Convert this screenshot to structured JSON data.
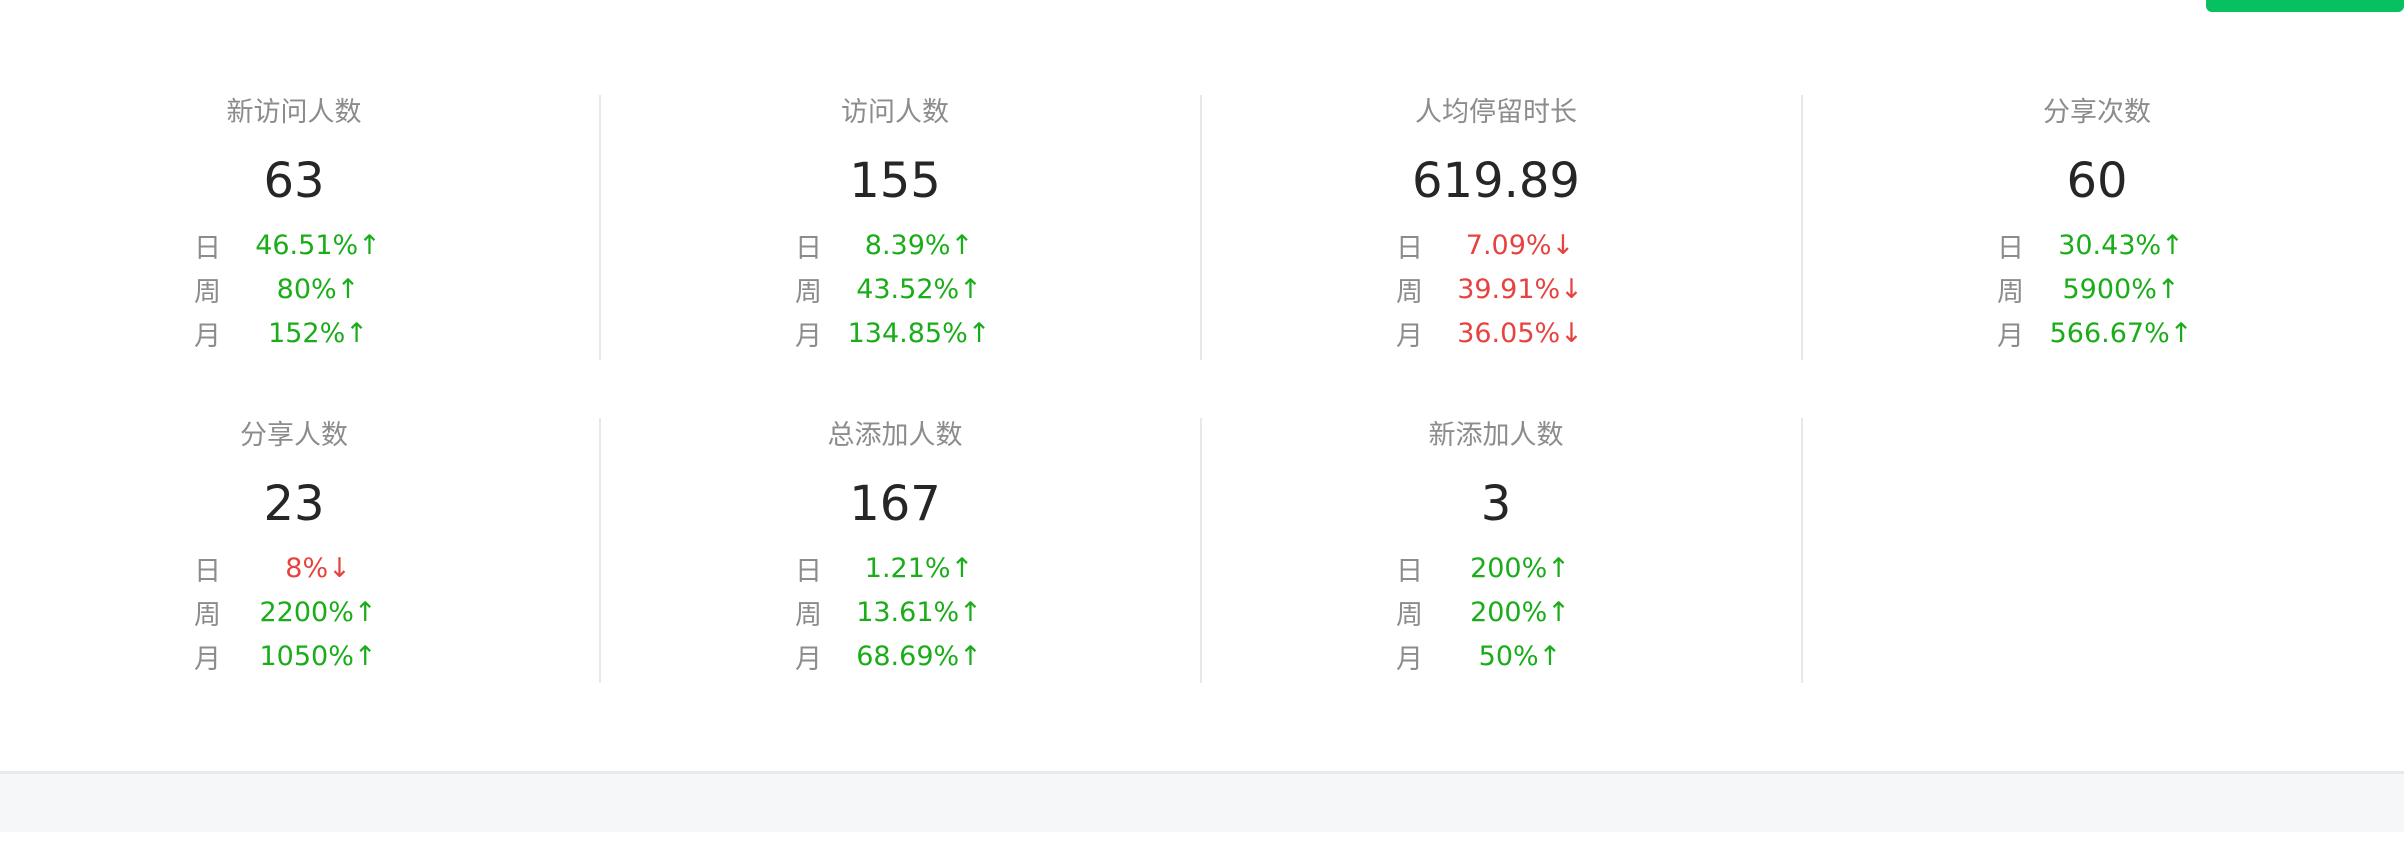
{
  "metrics": [
    {
      "label": "新访问人数",
      "value": "63",
      "day": "46.51%↑",
      "week": "80%↑",
      "month": "152%↑",
      "trend": [
        "up",
        "up",
        "up"
      ]
    },
    {
      "label": "访问人数",
      "value": "155",
      "day": "8.39%↑",
      "week": "43.52%↑",
      "month": "134.85%↑",
      "trend": [
        "up",
        "up",
        "up"
      ]
    },
    {
      "label": "人均停留时长",
      "value": "619.89",
      "day": "7.09%↓",
      "week": "39.91%↓",
      "month": "36.05%↓",
      "trend": [
        "down",
        "down",
        "down"
      ]
    },
    {
      "label": "分享次数",
      "value": "60",
      "day": "30.43%↑",
      "week": "5900%↑",
      "month": "566.67%↑",
      "trend": [
        "up",
        "up",
        "up"
      ]
    },
    {
      "label": "分享人数",
      "value": "23",
      "day": "8%↓",
      "week": "2200%↑",
      "month": "1050%↑",
      "trend": [
        "down",
        "up",
        "up"
      ]
    },
    {
      "label": "总添加人数",
      "value": "167",
      "day": "1.21%↑",
      "week": "13.61%↑",
      "month": "68.69%↑",
      "trend": [
        "up",
        "up",
        "up"
      ]
    },
    {
      "label": "新添加人数",
      "value": "3",
      "day": "200%↑",
      "week": "200%↑",
      "month": "50%↑",
      "trend": [
        "up",
        "up",
        "up"
      ]
    }
  ],
  "period_labels": {
    "day": "日",
    "week": "周",
    "month": "月"
  },
  "colors": {
    "up": "#1aad19",
    "down": "#e64340",
    "accent": "#07c160"
  }
}
